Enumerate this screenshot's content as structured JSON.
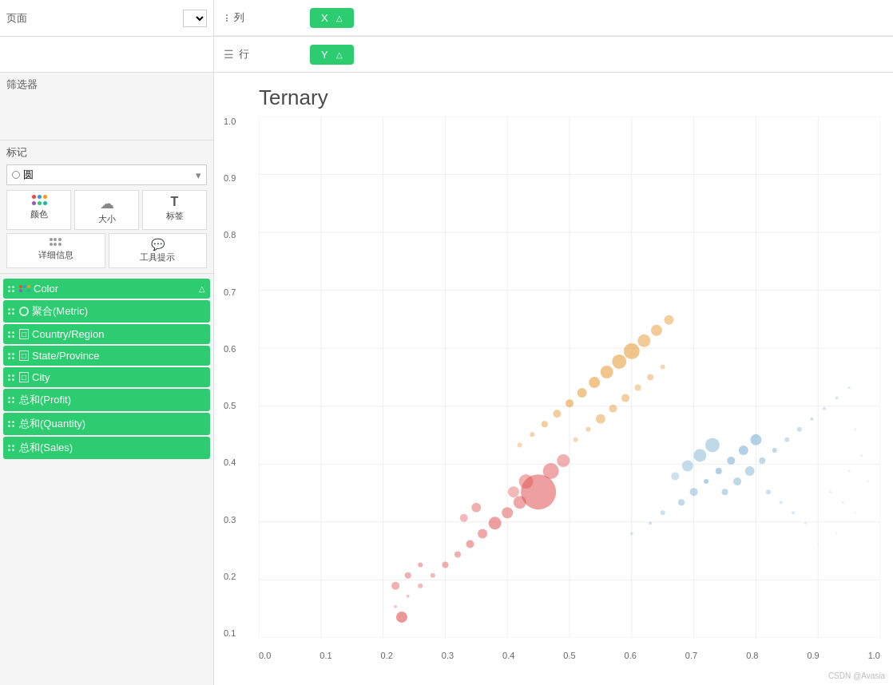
{
  "sidebar": {
    "page_label": "页面",
    "filter_label": "筛选器",
    "marks_label": "标记",
    "marks_type": "圆",
    "marks_buttons": [
      {
        "label": "颜色",
        "icon": "🎨"
      },
      {
        "label": "大小",
        "icon": "☁"
      },
      {
        "label": "标签",
        "icon": "T"
      },
      {
        "label": "详细信息",
        "icon": "⋯"
      },
      {
        "label": "工具提示",
        "icon": "💬"
      }
    ],
    "fields": [
      {
        "name": "Color",
        "type": "color",
        "green": true,
        "has_triangle": true
      },
      {
        "name": "聚合(Metric)",
        "type": "ring",
        "green": true
      },
      {
        "name": "Country/Region",
        "type": "box",
        "green": true
      },
      {
        "name": "State/Province",
        "type": "box",
        "green": true
      },
      {
        "name": "City",
        "type": "box",
        "green": true
      },
      {
        "name": "总和(Profit)",
        "type": "dots",
        "green": true
      },
      {
        "name": "总和(Quantity)",
        "type": "dots",
        "green": true
      },
      {
        "name": "总和(Sales)",
        "type": "dots",
        "green": true
      }
    ]
  },
  "columns": {
    "label": "列",
    "pill": "X",
    "triangle": "△"
  },
  "rows": {
    "label": "行",
    "pill": "Y",
    "triangle": "△"
  },
  "chart": {
    "title": "Ternary",
    "y_axis": [
      "1.0",
      "0.9",
      "0.8",
      "0.7",
      "0.6",
      "0.5",
      "0.4",
      "0.3",
      "0.2",
      "0.1"
    ],
    "x_axis": [
      "0.0",
      "0.1",
      "0.2",
      "0.3",
      "0.4",
      "0.5",
      "0.6",
      "0.7",
      "0.8",
      "0.9",
      "1.0"
    ]
  },
  "watermark": "CSDN @Avasia"
}
